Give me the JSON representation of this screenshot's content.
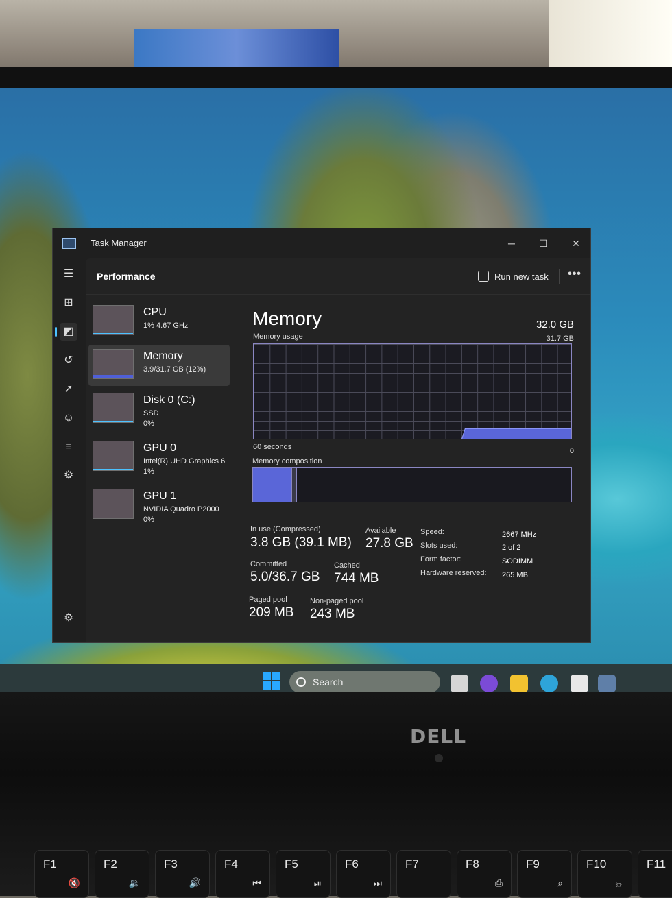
{
  "window": {
    "title": "Task Manager"
  },
  "header": {
    "page_title": "Performance",
    "run_new_task": "Run new task",
    "more_glyph": "•••"
  },
  "devices": [
    {
      "name": "CPU",
      "sub": "1%  4.67 GHz",
      "sub2": ""
    },
    {
      "name": "Memory",
      "sub": "3.9/31.7 GB (12%)",
      "sub2": ""
    },
    {
      "name": "Disk 0 (C:)",
      "sub": "SSD",
      "sub2": "0%"
    },
    {
      "name": "GPU 0",
      "sub": "Intel(R) UHD Graphics 6",
      "sub2": "1%"
    },
    {
      "name": "GPU 1",
      "sub": "NVIDIA Quadro P2000",
      "sub2": "0%"
    }
  ],
  "memory": {
    "title": "Memory",
    "total": "32.0 GB",
    "usage_label": "Memory usage",
    "max_label": "31.7 GB",
    "time_label": "60 seconds",
    "zero_label": "0",
    "composition_label": "Memory composition",
    "composition": {
      "in_use_fraction": 0.12,
      "modified_fraction": 0.01
    },
    "usage_history": [
      0,
      0,
      0,
      0,
      0,
      0,
      0,
      0,
      0,
      0,
      0,
      0,
      0,
      0,
      0,
      0,
      0,
      0,
      0,
      0,
      0,
      0,
      0,
      0,
      0,
      0,
      0,
      0,
      0,
      0,
      0,
      0,
      0,
      0,
      0,
      0,
      0,
      0,
      0,
      0,
      0,
      0,
      0,
      0,
      0,
      0,
      0,
      0,
      0,
      0,
      0,
      0,
      0,
      0,
      0,
      0,
      0,
      0,
      0,
      0.12,
      0.12,
      0.12,
      0.12,
      0.12,
      0.12,
      0.12,
      0.12,
      0.12,
      0.12,
      0.12,
      0.12,
      0.12,
      0.12,
      0.12,
      0.12,
      0.12,
      0.12,
      0.12,
      0.12,
      0.12,
      0.12,
      0.12,
      0.12,
      0.12,
      0.12,
      0.12,
      0.12,
      0.12,
      0.12,
      0.12
    ]
  },
  "stats": {
    "in_use_label": "In use (Compressed)",
    "in_use": "3.8 GB (39.1 MB)",
    "available_label": "Available",
    "available": "27.8 GB",
    "committed_label": "Committed",
    "committed": "5.0/36.7 GB",
    "cached_label": "Cached",
    "cached": "744 MB",
    "paged_label": "Paged pool",
    "paged": "209 MB",
    "nonpaged_label": "Non-paged pool",
    "nonpaged": "243 MB"
  },
  "details": [
    {
      "key": "Speed:",
      "value": "2667 MHz"
    },
    {
      "key": "Slots used:",
      "value": "2 of 2"
    },
    {
      "key": "Form factor:",
      "value": "SODIMM"
    },
    {
      "key": "Hardware reserved:",
      "value": "265 MB"
    }
  ],
  "taskbar": {
    "search_label": "Search"
  },
  "laptop": {
    "brand": "DELL"
  },
  "keys": [
    "F1",
    "F2",
    "F3",
    "F4",
    "F5",
    "F6",
    "F7",
    "F8",
    "F9",
    "F10",
    "F11"
  ],
  "colors": {
    "accent": "#4cc2ff",
    "memory_fill": "#5a66d8"
  }
}
